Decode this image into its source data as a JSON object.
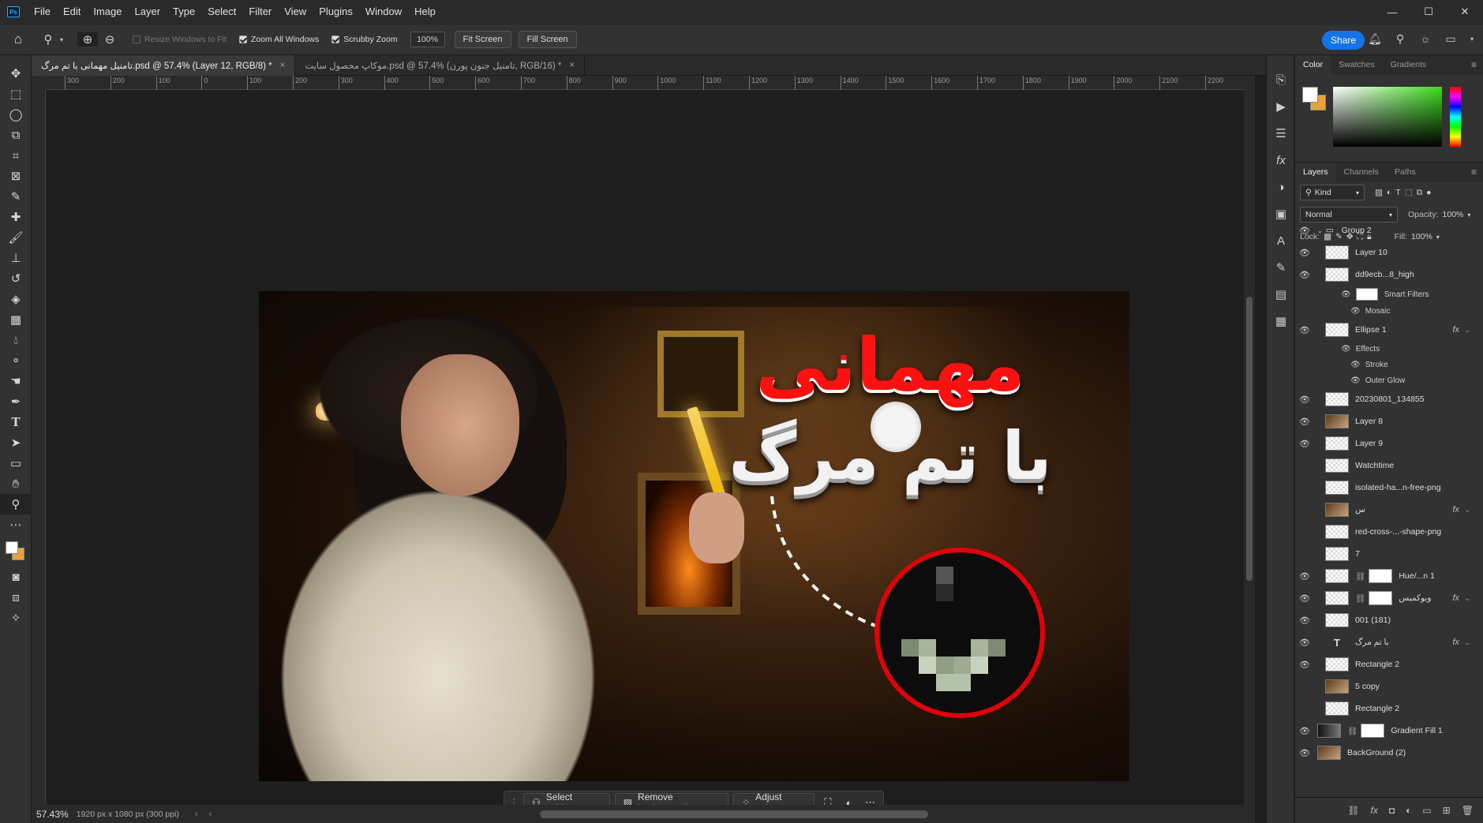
{
  "app": {
    "logo": "Ps"
  },
  "menu": [
    "File",
    "Edit",
    "Image",
    "Layer",
    "Type",
    "Select",
    "Filter",
    "View",
    "Plugins",
    "Window",
    "Help"
  ],
  "window_controls": [
    "—",
    "☐",
    "✕"
  ],
  "options": {
    "resize_windows": "Resize Windows to Fit",
    "zoom_all": "Zoom All Windows",
    "scrubby": "Scrubby Zoom",
    "zoom_value": "100%",
    "fit_screen": "Fit Screen",
    "fill_screen": "Fill Screen",
    "share": "Share"
  },
  "tabs": [
    {
      "label": "تامنیل مهمانی با تم مرگ.psd @ 57.4% (Layer 12, RGB/8) *",
      "close": "×"
    },
    {
      "label": "موکاپ محصول سایت.psd @ 57.4% (تامنیل جنون پورن, RGB/16) *",
      "close": "×"
    }
  ],
  "ruler_ticks": [
    "300",
    "200",
    "100",
    "0",
    "100",
    "200",
    "300",
    "400",
    "500",
    "600",
    "700",
    "800",
    "900",
    "1000",
    "1100",
    "1200",
    "1300",
    "1400",
    "1500",
    "1600",
    "1700",
    "1800",
    "1900",
    "2000",
    "2100",
    "2200"
  ],
  "image": {
    "title_top": "مهمانی",
    "title_bottom": "با تم مرگ"
  },
  "context_bar": {
    "select_subject": "Select subject",
    "remove_background": "Remove background",
    "adjust_colors": "Adjust colors"
  },
  "status": {
    "zoom": "57.43%",
    "info": "1920 px x 1080 px (300 ppi)"
  },
  "color_panel": {
    "tabs": [
      "Color",
      "Swatches",
      "Gradients"
    ],
    "fg": "#ffffff",
    "bg": "#e8a23a"
  },
  "layers_panel": {
    "tabs": [
      "Layers",
      "Channels",
      "Paths"
    ],
    "filter": "Kind",
    "blend": "Normal",
    "opacity_label": "Opacity:",
    "opacity": "100%",
    "lock_label": "Lock:",
    "fill_label": "Fill:",
    "fill": "100%",
    "layers": [
      {
        "name": "Group 2",
        "type": "group",
        "visible": true
      },
      {
        "name": "Layer 10",
        "type": "px",
        "visible": true
      },
      {
        "name": "dd9ecb...8_high",
        "type": "smart",
        "visible": true
      },
      {
        "name": "Smart Filters",
        "type": "sub"
      },
      {
        "name": "Mosaic",
        "type": "sub2"
      },
      {
        "name": "Ellipse 1",
        "type": "shape",
        "visible": true,
        "fx": true
      },
      {
        "name": "Effects",
        "type": "sub"
      },
      {
        "name": "Stroke",
        "type": "sub2"
      },
      {
        "name": "Outer Glow",
        "type": "sub2"
      },
      {
        "name": "20230801_134855",
        "type": "px",
        "visible": true
      },
      {
        "name": "Layer 8",
        "type": "img",
        "visible": true
      },
      {
        "name": "Layer 9",
        "type": "px",
        "visible": true
      },
      {
        "name": "Watchtime",
        "type": "px",
        "visible": false
      },
      {
        "name": "isolated-ha...n-free-png",
        "type": "px",
        "visible": false
      },
      {
        "name": "س",
        "type": "img",
        "visible": false,
        "fx": true
      },
      {
        "name": "red-cross-...-shape-png",
        "type": "px",
        "visible": false
      },
      {
        "name": "7",
        "type": "px",
        "visible": false
      },
      {
        "name": "Hue/...n 1",
        "type": "adj",
        "visible": true
      },
      {
        "name": "ویوکمیس",
        "type": "white",
        "visible": true,
        "fx": true
      },
      {
        "name": "001 (181)",
        "type": "px",
        "visible": true
      },
      {
        "name": "با تم مرگ",
        "type": "txt",
        "visible": true,
        "fx": true
      },
      {
        "name": "Rectangle 2",
        "type": "shape",
        "visible": true
      },
      {
        "name": "5 copy",
        "type": "img",
        "visible": false
      },
      {
        "name": "Rectangle 2",
        "type": "shape",
        "visible": false
      },
      {
        "name": "Gradient Fill 1",
        "type": "grad",
        "visible": true
      },
      {
        "name": "BackGround (2)",
        "type": "img",
        "visible": true
      }
    ]
  },
  "colors": {
    "accent": "#1473e6",
    "red": "#e0000a"
  }
}
